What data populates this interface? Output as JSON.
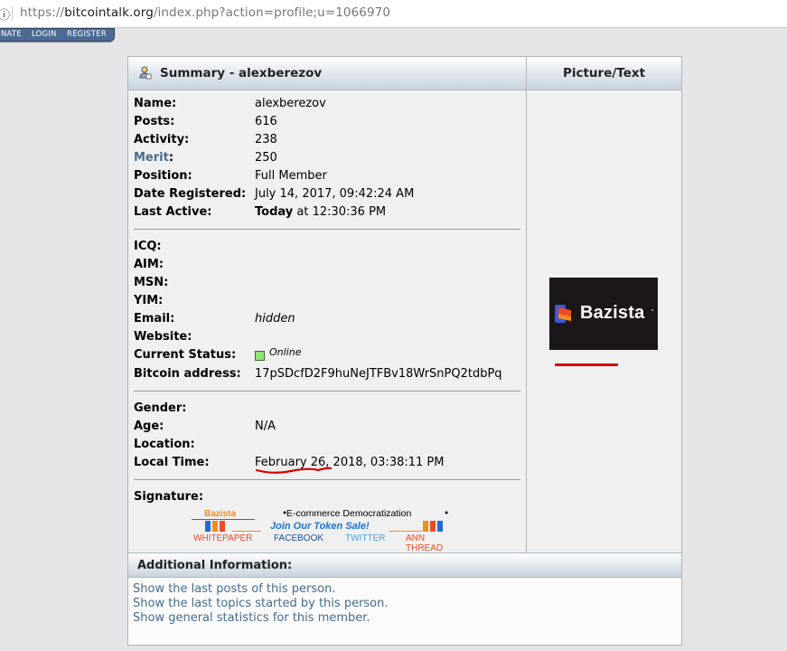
{
  "browser": {
    "url_scheme": "https://",
    "url_host": "bitcointalk.org",
    "url_path": "/index.php?action=profile;u=1066970"
  },
  "topnav": {
    "items": [
      "NATE",
      "LOGIN",
      "REGISTER"
    ]
  },
  "summary": {
    "title": "Summary - alexberezov",
    "picture_header": "Picture/Text",
    "fields": [
      {
        "label": "Name:",
        "value": "alexberezov"
      },
      {
        "label": "Posts:",
        "value": "616"
      },
      {
        "label": "Activity:",
        "value": "238"
      },
      {
        "label_link": "Merit",
        "label": ":",
        "value": "250"
      },
      {
        "label": "Position:",
        "value": "Full Member"
      },
      {
        "label": "Date Registered:",
        "value": "July 14, 2017, 09:42:24 AM"
      },
      {
        "label": "Last Active:",
        "value_bold": "Today",
        "value": " at 12:30:36 PM"
      }
    ],
    "contact": [
      {
        "label": "ICQ:",
        "value": ""
      },
      {
        "label": "AIM:",
        "value": ""
      },
      {
        "label": "MSN:",
        "value": ""
      },
      {
        "label": "YIM:",
        "value": ""
      },
      {
        "label": "Email:",
        "value": "hidden"
      },
      {
        "label": "Website:",
        "value": ""
      },
      {
        "label": "Current Status:",
        "value": "Online"
      },
      {
        "label": "Bitcoin address:",
        "value": "17pSDcfD2F9huNeJTFBv18WrSnPQ2tdbPq"
      }
    ],
    "personal": [
      {
        "label": "Gender:",
        "value": ""
      },
      {
        "label": "Age:",
        "value": "N/A"
      },
      {
        "label": "Location:",
        "value": ""
      },
      {
        "label": "Local Time:",
        "value": "February 26, 2018, 03:38:11 PM"
      }
    ],
    "signature_label": "Signature:"
  },
  "avatar": {
    "text": "Bazista"
  },
  "signature": {
    "brand": "Bazista",
    "slogan": "E-commerce Democratization",
    "bullet": "•",
    "sale": "Join Our Token Sale!",
    "links": [
      "WHITEPAPER",
      "FACEBOOK",
      "TWITTER",
      "ANN THREAD"
    ]
  },
  "colors": {
    "link": "#476c8e",
    "orange": "#f08d1e",
    "blue": "#2a6cc8",
    "red_annotation": "#d00000"
  },
  "additional": {
    "title": "Additional Information:",
    "links": [
      "Show the last posts of this person.",
      "Show the last topics started by this person.",
      "Show general statistics for this member."
    ]
  }
}
